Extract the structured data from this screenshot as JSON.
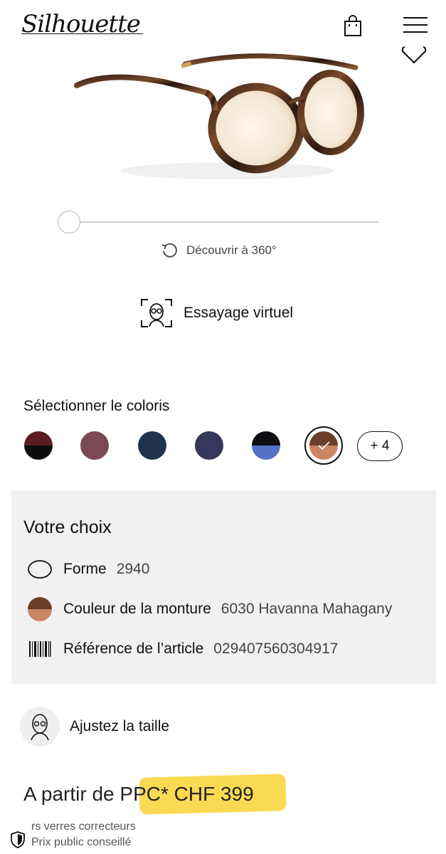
{
  "header": {
    "logo": "Silhouette"
  },
  "viewer": {
    "discover_label": "Découvrir à 360°",
    "tryon_label": "Essayage virtuel"
  },
  "colors": {
    "title": "Sélectionner le coloris",
    "more_label": "+ 4",
    "swatches": [
      {
        "top": "#5a1c20",
        "bottom": "#0c0c0c"
      },
      {
        "top": "#7a4954",
        "bottom": "#7a4954"
      },
      {
        "top": "#21324c",
        "bottom": "#21324c"
      },
      {
        "top": "#35385a",
        "bottom": "#35385a"
      },
      {
        "top": "#0d0d12",
        "bottom": "#5570c4"
      },
      {
        "top": "#6b3e2a",
        "bottom": "#c98663"
      }
    ],
    "selected_index": 5
  },
  "choice": {
    "title": "Votre choix",
    "rows": [
      {
        "label": "Forme",
        "value": "2940"
      },
      {
        "label": "Couleur de la monture",
        "value": "6030 Havanna Mahagany"
      },
      {
        "label": "Référence de l’article",
        "value": "029407560304917"
      }
    ]
  },
  "size": {
    "label": "Ajustez la taille"
  },
  "price": {
    "line": "A partir de PPC* CHF 399",
    "note1": "rs verres correcteurs",
    "note2": "Prix public conseillé"
  }
}
